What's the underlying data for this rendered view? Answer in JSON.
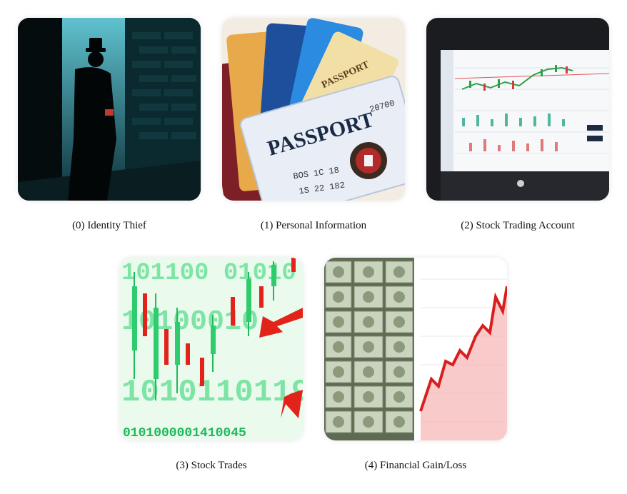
{
  "items": [
    {
      "index": "(0)",
      "label": "Identity Thief",
      "icon": "identity-thief-image"
    },
    {
      "index": "(1)",
      "label": "Personal Information",
      "icon": "personal-information-image"
    },
    {
      "index": "(2)",
      "label": "Stock Trading Account",
      "icon": "stock-trading-account-image"
    },
    {
      "index": "(3)",
      "label": "Stock Trades",
      "icon": "stock-trades-image"
    },
    {
      "index": "(4)",
      "label": "Financial Gain/Loss",
      "icon": "financial-gain-loss-image"
    }
  ],
  "card_texts": {
    "passport_big": "PASSPORT",
    "passport_small": "PASSPORT",
    "id_line1": "BOS 1C 18",
    "id_line2": "1S 22 182",
    "id_number": "20700"
  },
  "binary_text": {
    "row1": "101100 01010",
    "row2": "10100010",
    "row3": "1010110119",
    "row4": "0101000001410045"
  },
  "colors": {
    "thief_sky": "#3fa6b6",
    "green_matrix": "#27d36a",
    "red_candle": "#e2231a",
    "chart_red": "#d81e1e"
  }
}
